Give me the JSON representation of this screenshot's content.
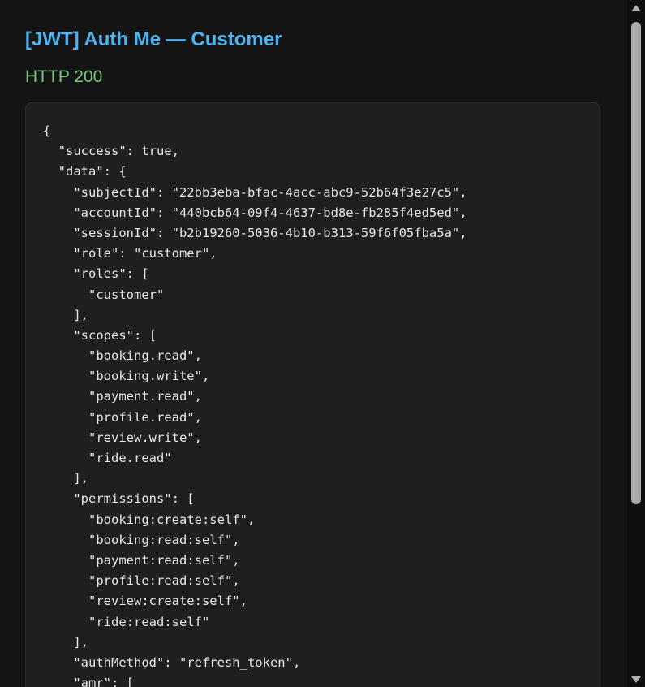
{
  "title": "[JWT] Auth Me — Customer",
  "status": "HTTP 200",
  "colors": {
    "title": "#4fb3f0",
    "status_ok": "#7cc47a",
    "background": "#141414",
    "panel": "#1f1f1f",
    "code_text": "#e6e6e6"
  },
  "json_lines": [
    "{",
    "  \"success\": true,",
    "  \"data\": {",
    "    \"subjectId\": \"22bb3eba-bfac-4acc-abc9-52b64f3e27c5\",",
    "    \"accountId\": \"440bcb64-09f4-4637-bd8e-fb285f4ed5ed\",",
    "    \"sessionId\": \"b2b19260-5036-4b10-b313-59f6f05fba5a\",",
    "    \"role\": \"customer\",",
    "    \"roles\": [",
    "      \"customer\"",
    "    ],",
    "    \"scopes\": [",
    "      \"booking.read\",",
    "      \"booking.write\",",
    "      \"payment.read\",",
    "      \"profile.read\",",
    "      \"review.write\",",
    "      \"ride.read\"",
    "    ],",
    "    \"permissions\": [",
    "      \"booking:create:self\",",
    "      \"booking:read:self\",",
    "      \"payment:read:self\",",
    "      \"profile:read:self\",",
    "      \"review:create:self\",",
    "      \"ride:read:self\"",
    "    ],",
    "    \"authMethod\": \"refresh_token\",",
    "    \"amr\": ["
  ],
  "scrollbar": {
    "up_icon": "triangle-up",
    "down_icon": "triangle-down"
  }
}
